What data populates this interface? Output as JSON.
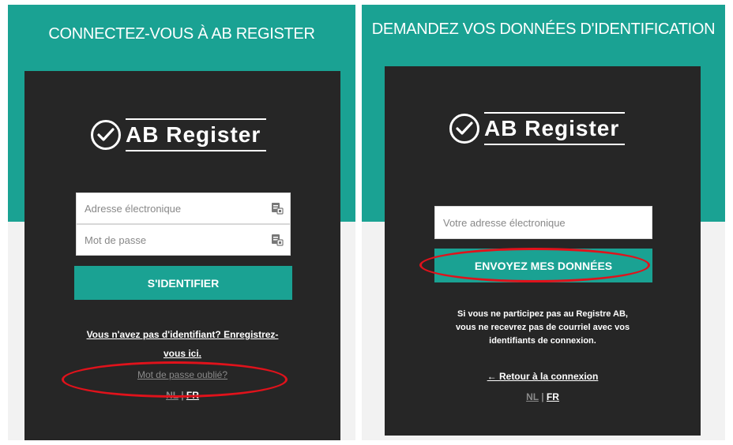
{
  "left_panel": {
    "title": "CONNECTEZ-VOUS À AB REGISTER",
    "logo_text": "AB Register",
    "email_placeholder": "Adresse électronique",
    "password_placeholder": "Mot de passe",
    "login_button": "S'IDENTIFIER",
    "register_link_line1": "Vous n'avez pas d'identifiant? Enregistrez-",
    "register_link_line2": "vous ici.",
    "forgot_password": "Mot de passe oublié?",
    "lang_nl": "NL",
    "lang_sep": "|",
    "lang_fr": "FR"
  },
  "right_panel": {
    "title": "DEMANDEZ VOS DONNÉES D'IDENTIFICATION",
    "logo_text": "AB Register",
    "email_placeholder": "Votre adresse électronique",
    "send_button": "ENVOYEZ MES DONNÉES",
    "info_line1": "Si vous ne participez pas au Registre AB,",
    "info_line2": "vous ne recevrez pas de courriel avec vos",
    "info_line3": "identifiants de connexion.",
    "back_link": "← Retour à la connexion",
    "lang_nl": "NL",
    "lang_sep": "|",
    "lang_fr": "FR"
  },
  "colors": {
    "teal": "#1aa293",
    "card": "#262626",
    "highlight": "#e0121b"
  },
  "icons": {
    "field_icon": "keypass-icon",
    "logo_icon": "check-circle-icon"
  }
}
